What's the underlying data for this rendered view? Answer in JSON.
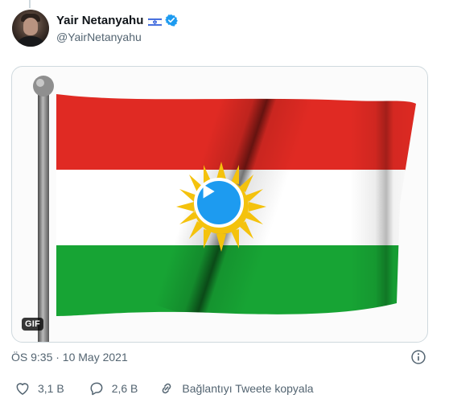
{
  "tweet": {
    "author": {
      "display_name": "Yair Netanyahu",
      "handle": "@YairNetanyahu",
      "flag": "israel-flag-icon",
      "verified": true
    },
    "media": {
      "type": "gif",
      "badge": "GIF",
      "subject": "kurdistan-flag",
      "flag_colors": {
        "red": "#e02a23",
        "white": "#ffffff",
        "green": "#17a434",
        "sun": "#f4c20d"
      }
    },
    "timestamp": "ÖS 9:35 · 10 May 2021",
    "actions": {
      "likes": "3,1 B",
      "replies": "2,6 B",
      "copy_link_label": "Bağlantıyı Tweete kopyala"
    },
    "colors": {
      "accent": "#1d9bf0",
      "text": "#0f1419",
      "secondary": "#536471",
      "border": "#cfd9de"
    }
  }
}
